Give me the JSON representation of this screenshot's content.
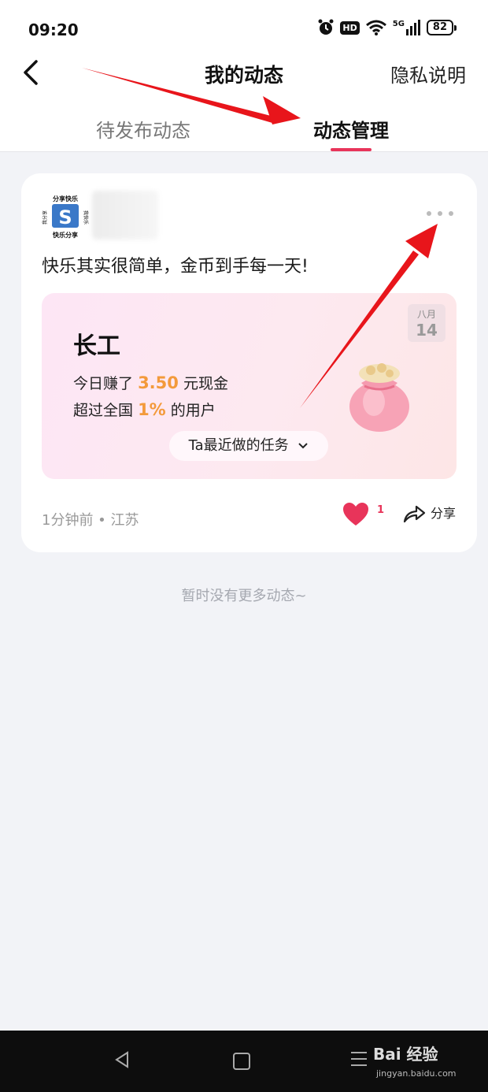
{
  "status_bar": {
    "time": "09:20",
    "hd_label": "HD",
    "network_label": "5G",
    "battery": "82"
  },
  "header": {
    "title": "我的动态",
    "privacy_label": "隐私说明"
  },
  "tabs": [
    {
      "label": "待发布动态"
    },
    {
      "label": "动态管理"
    }
  ],
  "post": {
    "text": "快乐其实很简单，金币到手每一天!",
    "task_card": {
      "date_month": "八月",
      "date_day": "14",
      "title": "长工",
      "line1_prefix": "今日赚了",
      "amount": "3.50",
      "line1_suffix": "元现金",
      "line2_prefix": "超过全国",
      "percent": "1%",
      "line2_suffix": "的用户",
      "button_label": "Ta最近做的任务"
    },
    "meta": "1分钟前 • 江苏",
    "like_count": "1",
    "share_label": "分享"
  },
  "avatar": {
    "top_text": "分享快乐",
    "bottom_text": "快乐分享",
    "left_text": "我分享",
    "right_text": "我快乐",
    "letter": "S"
  },
  "empty_state": "暂时没有更多动态~",
  "watermark": {
    "brand": "Bai 经验",
    "url": "jingyan.baidu.com"
  },
  "colors": {
    "accent": "#e8345a",
    "highlight": "#f39a3b",
    "annotation_arrow": "#e8151b"
  }
}
